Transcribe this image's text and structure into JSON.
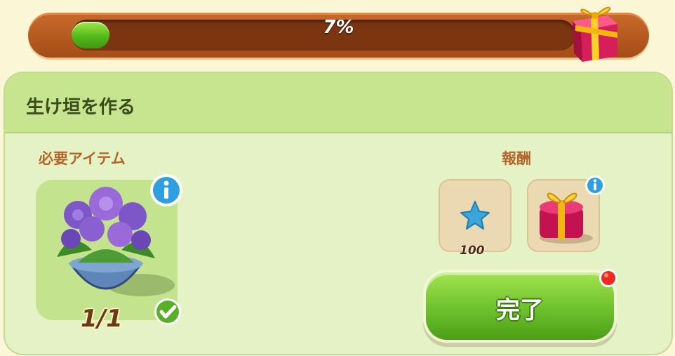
{
  "progress": {
    "percent_label": "7%",
    "fill_fraction": 0.07
  },
  "task": {
    "title": "生け垣を作る"
  },
  "required": {
    "label": "必要アイテム",
    "item_icon": "hydrangea-pot-icon",
    "count": "1/1",
    "status_icon": "checkmark-icon"
  },
  "reward": {
    "label": "報酬",
    "items": [
      {
        "icon": "blue-star-icon",
        "amount": "100"
      },
      {
        "icon": "gift-box-icon"
      }
    ]
  },
  "actions": {
    "complete_label": "完了"
  },
  "colors": {
    "panel_bg": "#e4f2c6",
    "header_bg": "#c6e58e",
    "progress_green": "#56b81b",
    "button_green": "#6cc12b",
    "label_brown": "#b3662a"
  }
}
